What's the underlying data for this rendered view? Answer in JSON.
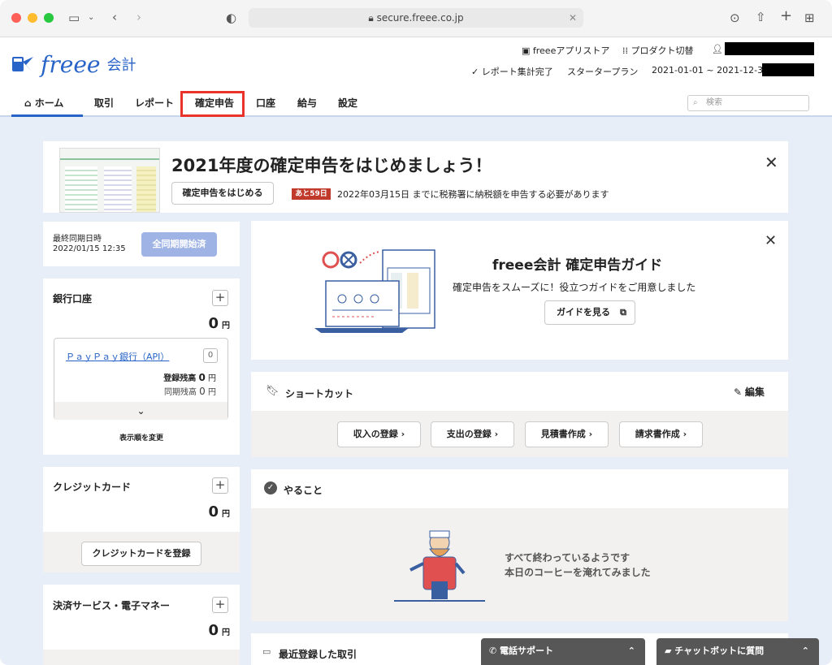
{
  "browser": {
    "url": "secure.freee.co.jp"
  },
  "header": {
    "logo_word": "freee",
    "logo_product": "会計",
    "app_store": "freeeアプリストア",
    "product_switch": "プロダクト切替",
    "report_status": "✓ レポート集計完了",
    "plan": "スタータープラン",
    "period": "2021-01-01 ~ 2021-12-31"
  },
  "nav": {
    "items": [
      {
        "label": "ホーム"
      },
      {
        "label": "取引"
      },
      {
        "label": "レポート"
      },
      {
        "label": "確定申告"
      },
      {
        "label": "口座"
      },
      {
        "label": "給与"
      },
      {
        "label": "設定"
      }
    ],
    "search_placeholder": "検索"
  },
  "banner": {
    "title": "2021年度の確定申告をはじめましょう！",
    "start_button": "確定申告をはじめる",
    "badge": "あと59日",
    "deadline_text": "2022年03月15日 までに税務署に納税額を申告する必要があります"
  },
  "sync": {
    "label": "最終同期日時",
    "datetime": "2022/01/15 12:35",
    "button": "全同期開始済"
  },
  "bank": {
    "title": "銀行口座",
    "total": "0",
    "unit": "円",
    "account_name": "ＰａｙＰａｙ銀行（API）",
    "account_badge": "0",
    "registered_label": "登録残高",
    "registered_value": "0",
    "synced_label": "同期残高",
    "synced_value": "0",
    "reorder": "表示順を変更"
  },
  "credit": {
    "title": "クレジットカード",
    "total": "0",
    "unit": "円",
    "register_button": "クレジットカードを登録"
  },
  "payment": {
    "title": "決済サービス・電子マネー",
    "total": "0",
    "unit": "円"
  },
  "guide": {
    "title": "freee会計 確定申告ガイド",
    "subtitle": "確定申告をスムーズに！役立つガイドをご用意しました",
    "button": "ガイドを見る"
  },
  "shortcut": {
    "title": "ショートカット",
    "edit": "編集",
    "items": [
      {
        "label": "収入の登録"
      },
      {
        "label": "支出の登録"
      },
      {
        "label": "見積書作成"
      },
      {
        "label": "請求書作成"
      }
    ]
  },
  "todo": {
    "title": "やること",
    "message_line1": "すべて終わっているようです",
    "message_line2": "本日のコーヒーを淹れてみました"
  },
  "recent": {
    "title": "最近登録した取引"
  },
  "support": {
    "phone": "電話サポート",
    "chatbot": "チャットボットに質問"
  },
  "colors": {
    "accent": "#2864c8",
    "highlight": "#e8322a",
    "badge": "#c0392b",
    "sync_button": "#9fb3e4"
  }
}
